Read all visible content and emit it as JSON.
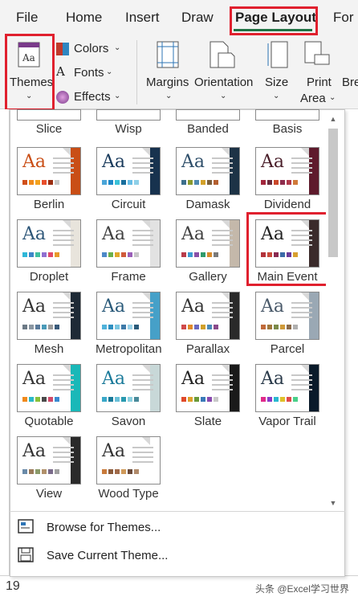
{
  "menu": {
    "tabs": [
      {
        "label": "File"
      },
      {
        "label": "Home"
      },
      {
        "label": "Insert"
      },
      {
        "label": "Draw"
      },
      {
        "label": "Page Layout"
      },
      {
        "label": "For"
      }
    ]
  },
  "ribbon": {
    "themes_label": "Themes",
    "colors_label": "Colors",
    "fonts_label": "Fonts",
    "effects_label": "Effects",
    "margins_label": "Margins",
    "orientation_label": "Orientation",
    "size_label": "Size",
    "print_area_label": "Print Area",
    "print_label": "Print",
    "area_label": "Area",
    "breaks_label": "Bre"
  },
  "gallery": {
    "partial_row": [
      "Slice",
      "Wisp",
      "Banded",
      "Basis"
    ],
    "themes": [
      {
        "name": "Berlin",
        "accent": "#c94e16",
        "bar": "#c94e16",
        "swatches": [
          "#d04f1a",
          "#f08a1c",
          "#f3a21e",
          "#e84e2b",
          "#9b2e12",
          "#c8c8c8"
        ]
      },
      {
        "name": "Circuit",
        "accent": "#1a3b5c",
        "bar": "#17324e",
        "swatches": [
          "#4aa5d8",
          "#1e88c8",
          "#3bc1d8",
          "#1a6e9c",
          "#67bde6",
          "#8fd0e8"
        ]
      },
      {
        "name": "Damask",
        "accent": "#2f4f6a",
        "bar": "#1d3346",
        "swatches": [
          "#3c6f8c",
          "#8a9a2f",
          "#4f8ab1",
          "#d3a12a",
          "#7a5f3c",
          "#b35f30"
        ]
      },
      {
        "name": "Dividend",
        "accent": "#4a1f2a",
        "bar": "#5e1a2c",
        "swatches": [
          "#a2263c",
          "#6a2a3c",
          "#c9472a",
          "#8e2d4d",
          "#b0384a",
          "#d07a3a"
        ]
      },
      {
        "name": "Droplet",
        "accent": "#2d5678",
        "bar": "#e8e4dc",
        "swatches": [
          "#2fb7d8",
          "#3c86c9",
          "#40c0a0",
          "#8f6fd0",
          "#e04a6a",
          "#e89a2a"
        ]
      },
      {
        "name": "Frame",
        "accent": "#404040",
        "bar": "#e2e2e2",
        "swatches": [
          "#4c88c8",
          "#6bb04a",
          "#e0a82a",
          "#d05a3a",
          "#9a5fb8",
          "#c8c8c8"
        ]
      },
      {
        "name": "Gallery",
        "accent": "#404040",
        "bar": "#c4b8aa",
        "swatches": [
          "#b83c4a",
          "#3d9ad2",
          "#8a4fa8",
          "#2f9a6a",
          "#d88a2a",
          "#7a7a7a"
        ]
      },
      {
        "name": "Main Event",
        "accent": "#222222",
        "bar": "#3a2a2a",
        "swatches": [
          "#b2323a",
          "#c84a3a",
          "#8a2a50",
          "#3a6aa8",
          "#6a3a9a",
          "#d8a030"
        ]
      },
      {
        "name": "Mesh",
        "accent": "#333333",
        "bar": "#1e2a36",
        "swatches": [
          "#6c7a86",
          "#8a96a2",
          "#5a7a9a",
          "#4a9ab8",
          "#9a9a9a",
          "#3a5a7a"
        ]
      },
      {
        "name": "Metropolitan",
        "accent": "#2a5a7a",
        "bar": "#46a0c8",
        "swatches": [
          "#50b2da",
          "#2e8fc0",
          "#7ac6e0",
          "#3e7aa8",
          "#9ad2e8",
          "#2a5a7a"
        ]
      },
      {
        "name": "Parallax",
        "accent": "#333333",
        "bar": "#2a2a2a",
        "swatches": [
          "#d04a4a",
          "#e08a2a",
          "#6a6ac0",
          "#d0a02a",
          "#4a8ab8",
          "#8a4a8a"
        ]
      },
      {
        "name": "Parcel",
        "accent": "#4a5a6a",
        "bar": "#9aa8b4",
        "swatches": [
          "#c06a3a",
          "#a0783c",
          "#7a8a4a",
          "#d09a3a",
          "#8a6a4a",
          "#b0b0b0"
        ]
      },
      {
        "name": "Quotable",
        "accent": "#333333",
        "bar": "#1ab8b8",
        "swatches": [
          "#f08a1c",
          "#2ab8c8",
          "#8ac03a",
          "#4a4a4a",
          "#d04a6a",
          "#3a8ad0"
        ]
      },
      {
        "name": "Savon",
        "accent": "#1a7a9a",
        "bar": "#c8d8d8",
        "swatches": [
          "#3aa8c8",
          "#1a7a9a",
          "#6ac0d8",
          "#2a9ab0",
          "#8ad0e0",
          "#4a8a9a"
        ]
      },
      {
        "name": "Slate",
        "accent": "#222222",
        "bar": "#1a1a1a",
        "swatches": [
          "#e04a2a",
          "#e0a02a",
          "#6a9a3a",
          "#3a7ab8",
          "#8a4ab0",
          "#c8c8c8"
        ]
      },
      {
        "name": "Vapor Trail",
        "accent": "#2a3a4a",
        "bar": "#0a1a2a",
        "swatches": [
          "#e02a8a",
          "#8a3ac8",
          "#2ab8d0",
          "#e0c02a",
          "#e04a4a",
          "#4ad08a"
        ]
      },
      {
        "name": "View",
        "accent": "#333333",
        "bar": "#2a2a2a",
        "swatches": [
          "#6a8aa8",
          "#9a7a5a",
          "#8a9a6a",
          "#b0906a",
          "#7a6a8a",
          "#a0a0a0"
        ]
      },
      {
        "name": "Wood Type",
        "accent": "#333333",
        "bar": "#ffffff",
        "swatches": [
          "#c87a3a",
          "#8a5a3a",
          "#a06a4a",
          "#d09a5a",
          "#6a4a3a",
          "#b08a6a"
        ]
      }
    ]
  },
  "actions": {
    "browse_label": "Browse for Themes...",
    "save_label": "Save Current Theme..."
  },
  "sheet": {
    "row_number": "19"
  },
  "watermark": "头条 @Excel学习世界",
  "colors": {
    "accent_green": "#1f7244",
    "highlight_red": "#e0202e"
  }
}
